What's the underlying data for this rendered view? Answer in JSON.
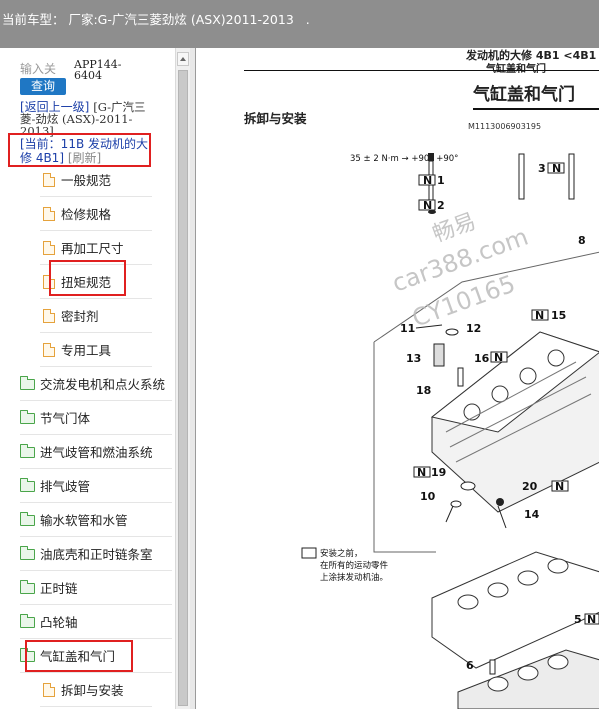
{
  "window": {
    "title": "当前车型： 厂家:G-广汽三菱劲炫 (ASX)2011-2013",
    "title_suffix": "."
  },
  "sidebar": {
    "search": {
      "hint": "输入关",
      "button": "查询",
      "app_code": "APP144-6404",
      "clear": "×"
    },
    "back_link": "[返回上一级]",
    "vehicle_path": "[G-广汽三菱-劲炫 (ASX)-2011-2013]",
    "current_label": "[当前：11B 发动机的大修 4B1]",
    "refresh": "[刷新]",
    "tree": [
      {
        "label": "一般规范",
        "kind": "doc",
        "level": 1
      },
      {
        "label": "检修规格",
        "kind": "doc",
        "level": 1
      },
      {
        "label": "再加工尺寸",
        "kind": "doc",
        "level": 1
      },
      {
        "label": "扭矩规范",
        "kind": "doc",
        "level": 1
      },
      {
        "label": "密封剂",
        "kind": "doc",
        "level": 1
      },
      {
        "label": "专用工具",
        "kind": "doc",
        "level": 1
      },
      {
        "label": "交流发电机和点火系统",
        "kind": "folder",
        "level": 0
      },
      {
        "label": "节气门体",
        "kind": "folder",
        "level": 0
      },
      {
        "label": "进气歧管和燃油系统",
        "kind": "folder",
        "level": 0
      },
      {
        "label": "排气歧管",
        "kind": "folder",
        "level": 0
      },
      {
        "label": "输水软管和水管",
        "kind": "folder",
        "level": 0
      },
      {
        "label": "油底壳和正时链条室",
        "kind": "folder",
        "level": 0
      },
      {
        "label": "正时链",
        "kind": "folder",
        "level": 0
      },
      {
        "label": "凸轮轴",
        "kind": "folder",
        "level": 0
      },
      {
        "label": "气缸盖和气门",
        "kind": "folder",
        "level": 0
      },
      {
        "label": "拆卸与安装",
        "kind": "doc",
        "level": 1
      }
    ]
  },
  "document": {
    "header": "发动机的大修 4B1 <4B1",
    "subheader": "气缸盖和气门",
    "title": "气缸盖和气门",
    "section": "拆卸与安装",
    "figure_code": "M1113006903195",
    "torque_spec": "35 ± 2 N·m → +90° +90°",
    "note_line1": "安装之前，",
    "note_line2": "在所有的运动零件",
    "note_line3": "上涂抹发动机油。",
    "parts": [
      "1",
      "2",
      "3",
      "8",
      "11",
      "12",
      "13",
      "14",
      "15",
      "16",
      "18",
      "19",
      "20",
      "5",
      "6",
      "10"
    ],
    "tags": [
      "N",
      "N",
      "N",
      "N",
      "N",
      "N",
      "N",
      "N"
    ],
    "watermark_1": "畅易",
    "watermark_2": "car388.com",
    "watermark_3": "CY10165"
  }
}
